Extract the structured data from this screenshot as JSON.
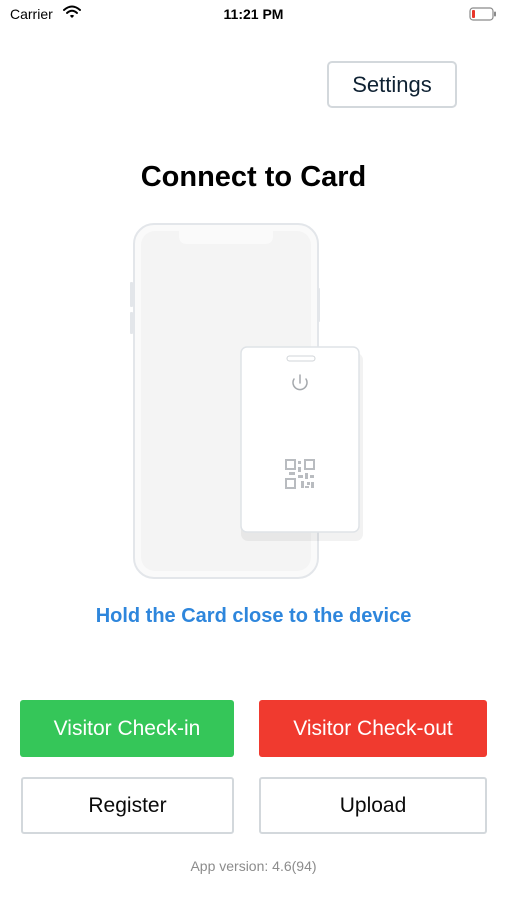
{
  "status_bar": {
    "carrier": "Carrier",
    "time": "11:21 PM",
    "wifi_icon": "wifi-icon",
    "battery_icon": "battery-low-icon",
    "battery_color": "#e8352a"
  },
  "header": {
    "settings_label": "Settings"
  },
  "main": {
    "title": "Connect to Card",
    "illustration_icons": [
      "phone-outline-icon",
      "card-icon",
      "power-icon",
      "qr-code-icon"
    ],
    "hint": "Hold the Card close to the device"
  },
  "actions": {
    "checkin_label": "Visitor Check-in",
    "checkout_label": "Visitor Check-out",
    "register_label": "Register",
    "upload_label": "Upload",
    "checkin_color": "#35c659",
    "checkout_color": "#f03a2f",
    "hint_color": "#2e86dc"
  },
  "footer": {
    "app_version": "App version: 4.6(94)"
  }
}
